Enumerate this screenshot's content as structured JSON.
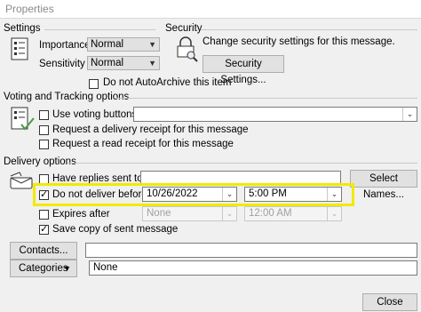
{
  "window": {
    "title": "Properties"
  },
  "settings": {
    "heading": "Settings",
    "importance_label": "Importance",
    "importance_value": "Normal",
    "sensitivity_label": "Sensitivity",
    "sensitivity_value": "Normal",
    "autoarchive_label": "Do not AutoArchive this item",
    "autoarchive_checked": false
  },
  "security": {
    "heading": "Security",
    "description": "Change security settings for this message.",
    "button_label": "Security Settings..."
  },
  "voting": {
    "heading": "Voting and Tracking options",
    "use_voting_label": "Use voting buttons",
    "use_voting_value": "",
    "delivery_receipt_label": "Request a delivery receipt for this message",
    "read_receipt_label": "Request a read receipt for this message"
  },
  "delivery": {
    "heading": "Delivery options",
    "replies_label": "Have replies sent to",
    "replies_value": "",
    "select_names_label": "Select Names...",
    "dnd_label": "Do not deliver before",
    "dnd_checked": true,
    "dnd_date": "10/26/2022",
    "dnd_time": "5:00 PM",
    "expires_label": "Expires after",
    "expires_checked": false,
    "expires_date": "None",
    "expires_time": "12:00 AM",
    "save_copy_label": "Save copy of sent message",
    "save_copy_checked": true
  },
  "contacts": {
    "button_label": "Contacts...",
    "value": ""
  },
  "categories": {
    "button_label": "Categories",
    "value": "None"
  },
  "footer": {
    "close_label": "Close"
  },
  "colors": {
    "highlight": "#f2e900"
  }
}
